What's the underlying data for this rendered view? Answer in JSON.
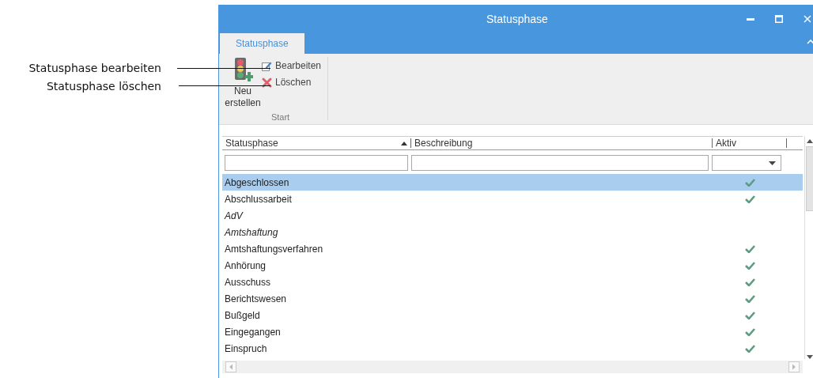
{
  "annotations": [
    {
      "text": "Statusphase bearbeiten"
    },
    {
      "text": "Statusphase löschen"
    }
  ],
  "window": {
    "title": "Statusphase"
  },
  "tabs": [
    {
      "label": "Statusphase",
      "selected": true
    }
  ],
  "ribbon": {
    "new_button": {
      "label": "Neu erstellen"
    },
    "small_buttons": [
      {
        "kind": "edit",
        "label": "Bearbeiten"
      },
      {
        "kind": "delete",
        "label": "Löschen"
      }
    ],
    "group_label": "Start"
  },
  "table": {
    "columns": [
      {
        "label": "Statusphase",
        "sorted": true
      },
      {
        "label": "Beschreibung",
        "sorted": false
      },
      {
        "label": "Aktiv",
        "sorted": false
      }
    ],
    "rows": [
      {
        "name": "Abgeschlossen",
        "italic": false,
        "active": true,
        "selected": true
      },
      {
        "name": "Abschlussarbeit",
        "italic": false,
        "active": true,
        "selected": false
      },
      {
        "name": "AdV",
        "italic": true,
        "active": false,
        "selected": false
      },
      {
        "name": "Amtshaftung",
        "italic": true,
        "active": false,
        "selected": false
      },
      {
        "name": "Amtshaftungsverfahren",
        "italic": false,
        "active": true,
        "selected": false
      },
      {
        "name": "Anhörung",
        "italic": false,
        "active": true,
        "selected": false
      },
      {
        "name": "Ausschuss",
        "italic": false,
        "active": true,
        "selected": false
      },
      {
        "name": "Berichtswesen",
        "italic": false,
        "active": true,
        "selected": false
      },
      {
        "name": "Bußgeld",
        "italic": false,
        "active": true,
        "selected": false
      },
      {
        "name": "Eingegangen",
        "italic": false,
        "active": true,
        "selected": false
      },
      {
        "name": "Einspruch",
        "italic": false,
        "active": true,
        "selected": false
      }
    ]
  }
}
